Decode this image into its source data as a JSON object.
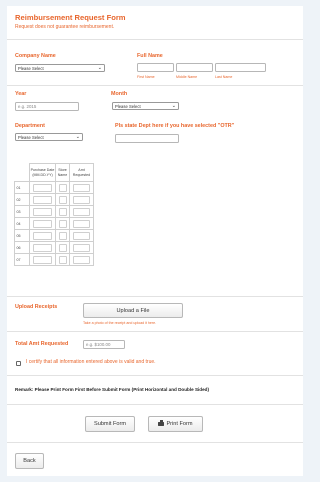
{
  "header": {
    "title": "Reimbursement Request Form",
    "subtitle": "Request does not guarantee reimbursement."
  },
  "company": {
    "label": "Company Name",
    "selected": "Please Select"
  },
  "full_name": {
    "label": "Full Name",
    "first_sub": "First Name",
    "middle_sub": "Middle Name",
    "last_sub": "Last Name"
  },
  "year": {
    "label": "Year",
    "placeholder": "e.g. 2015"
  },
  "month": {
    "label": "Month",
    "selected": "Please Select"
  },
  "department": {
    "label": "Department",
    "selected": "Please Select"
  },
  "other_dept": {
    "label": "Pls state Dept here if you have selected \"OTR\""
  },
  "table": {
    "headers": [
      "Purchase Date (MM.DD.YY)",
      "Store Name",
      "Amt Requested"
    ],
    "rows": [
      "01",
      "02",
      "03",
      "04",
      "05",
      "06",
      "07"
    ]
  },
  "upload": {
    "label": "Upload Receipts",
    "button": "Upload a File",
    "hint": "Take a photo of the receipt and upload it here."
  },
  "total": {
    "label": "Total Amt Requested",
    "placeholder": "e.g. $100.00"
  },
  "certify": {
    "text": "I certify that all information entered above is valid and true."
  },
  "remark": {
    "text": "Remark: Please Print Form First Before Submit Form (Print Horizontal and Double Sided)"
  },
  "actions": {
    "submit": "Submit Form",
    "print": "Print Form",
    "back": "Back"
  },
  "colors": {
    "accent": "#e8662d",
    "background": "#eef3f8"
  },
  "icons": {
    "print": "printer-icon",
    "select": "chevron-down-icon"
  }
}
